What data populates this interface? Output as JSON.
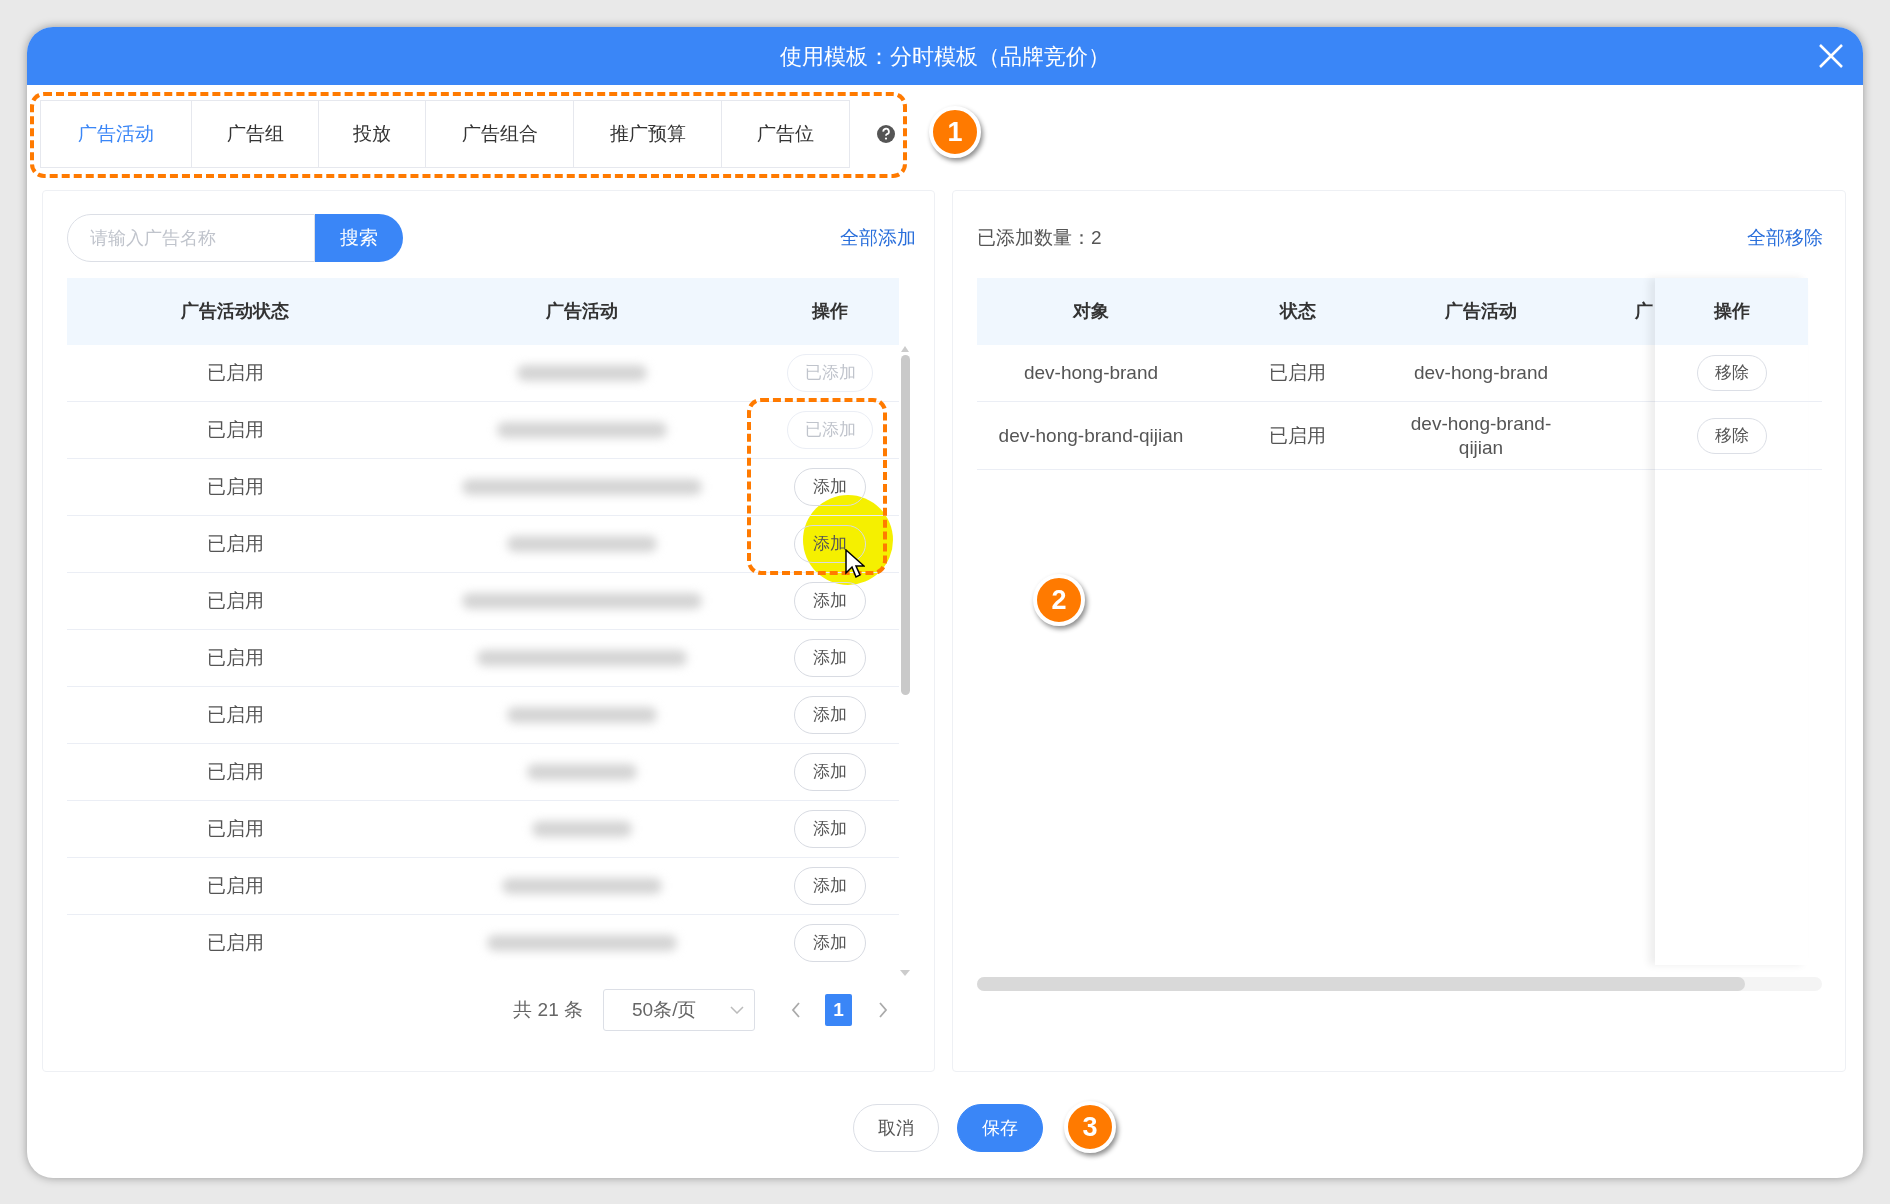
{
  "window": {
    "title": "使用模板：分时模板（品牌竞价）"
  },
  "tabs": [
    {
      "label": "广告活动",
      "selected": true
    },
    {
      "label": "广告组",
      "selected": false
    },
    {
      "label": "投放",
      "selected": false
    },
    {
      "label": "广告组合",
      "selected": false
    },
    {
      "label": "推广预算",
      "selected": false
    },
    {
      "label": "广告位",
      "selected": false
    }
  ],
  "left_panel": {
    "search": {
      "placeholder": "请输入广告名称"
    },
    "search_button": "搜索",
    "add_all": "全部添加",
    "columns": [
      "广告活动状态",
      "广告活动",
      "操作"
    ],
    "rows": [
      {
        "status": "已启用",
        "action": "已添加",
        "added": true
      },
      {
        "status": "已启用",
        "action": "已添加",
        "added": true
      },
      {
        "status": "已启用",
        "action": "添加",
        "added": false
      },
      {
        "status": "已启用",
        "action": "添加",
        "added": false
      },
      {
        "status": "已启用",
        "action": "添加",
        "added": false
      },
      {
        "status": "已启用",
        "action": "添加",
        "added": false
      },
      {
        "status": "已启用",
        "action": "添加",
        "added": false
      },
      {
        "status": "已启用",
        "action": "添加",
        "added": false
      },
      {
        "status": "已启用",
        "action": "添加",
        "added": false
      },
      {
        "status": "已启用",
        "action": "添加",
        "added": false
      },
      {
        "status": "已启用",
        "action": "添加",
        "added": false
      }
    ],
    "pagination": {
      "total": "共 21 条",
      "page_size": "50条/页",
      "pages": [
        {
          "label": "1",
          "selected": true
        }
      ]
    }
  },
  "right_panel": {
    "count_label": "已添加数量：2",
    "remove_all": "全部移除",
    "columns": [
      "对象",
      "状态",
      "广告活动",
      "广",
      "操作"
    ],
    "rows": [
      {
        "object": "dev-hong-brand",
        "status": "已启用",
        "campaign": "dev-hong-brand",
        "action": "移除"
      },
      {
        "object": "dev-hong-brand-qijian",
        "status": "已启用",
        "campaign": "dev-hong-brand-qijian",
        "action": "移除"
      }
    ]
  },
  "footer": {
    "buttons": [
      {
        "label": "取消",
        "kind": "secondary"
      },
      {
        "label": "保存",
        "kind": "primary"
      }
    ]
  },
  "annotations": [
    "1",
    "2",
    "3"
  ]
}
